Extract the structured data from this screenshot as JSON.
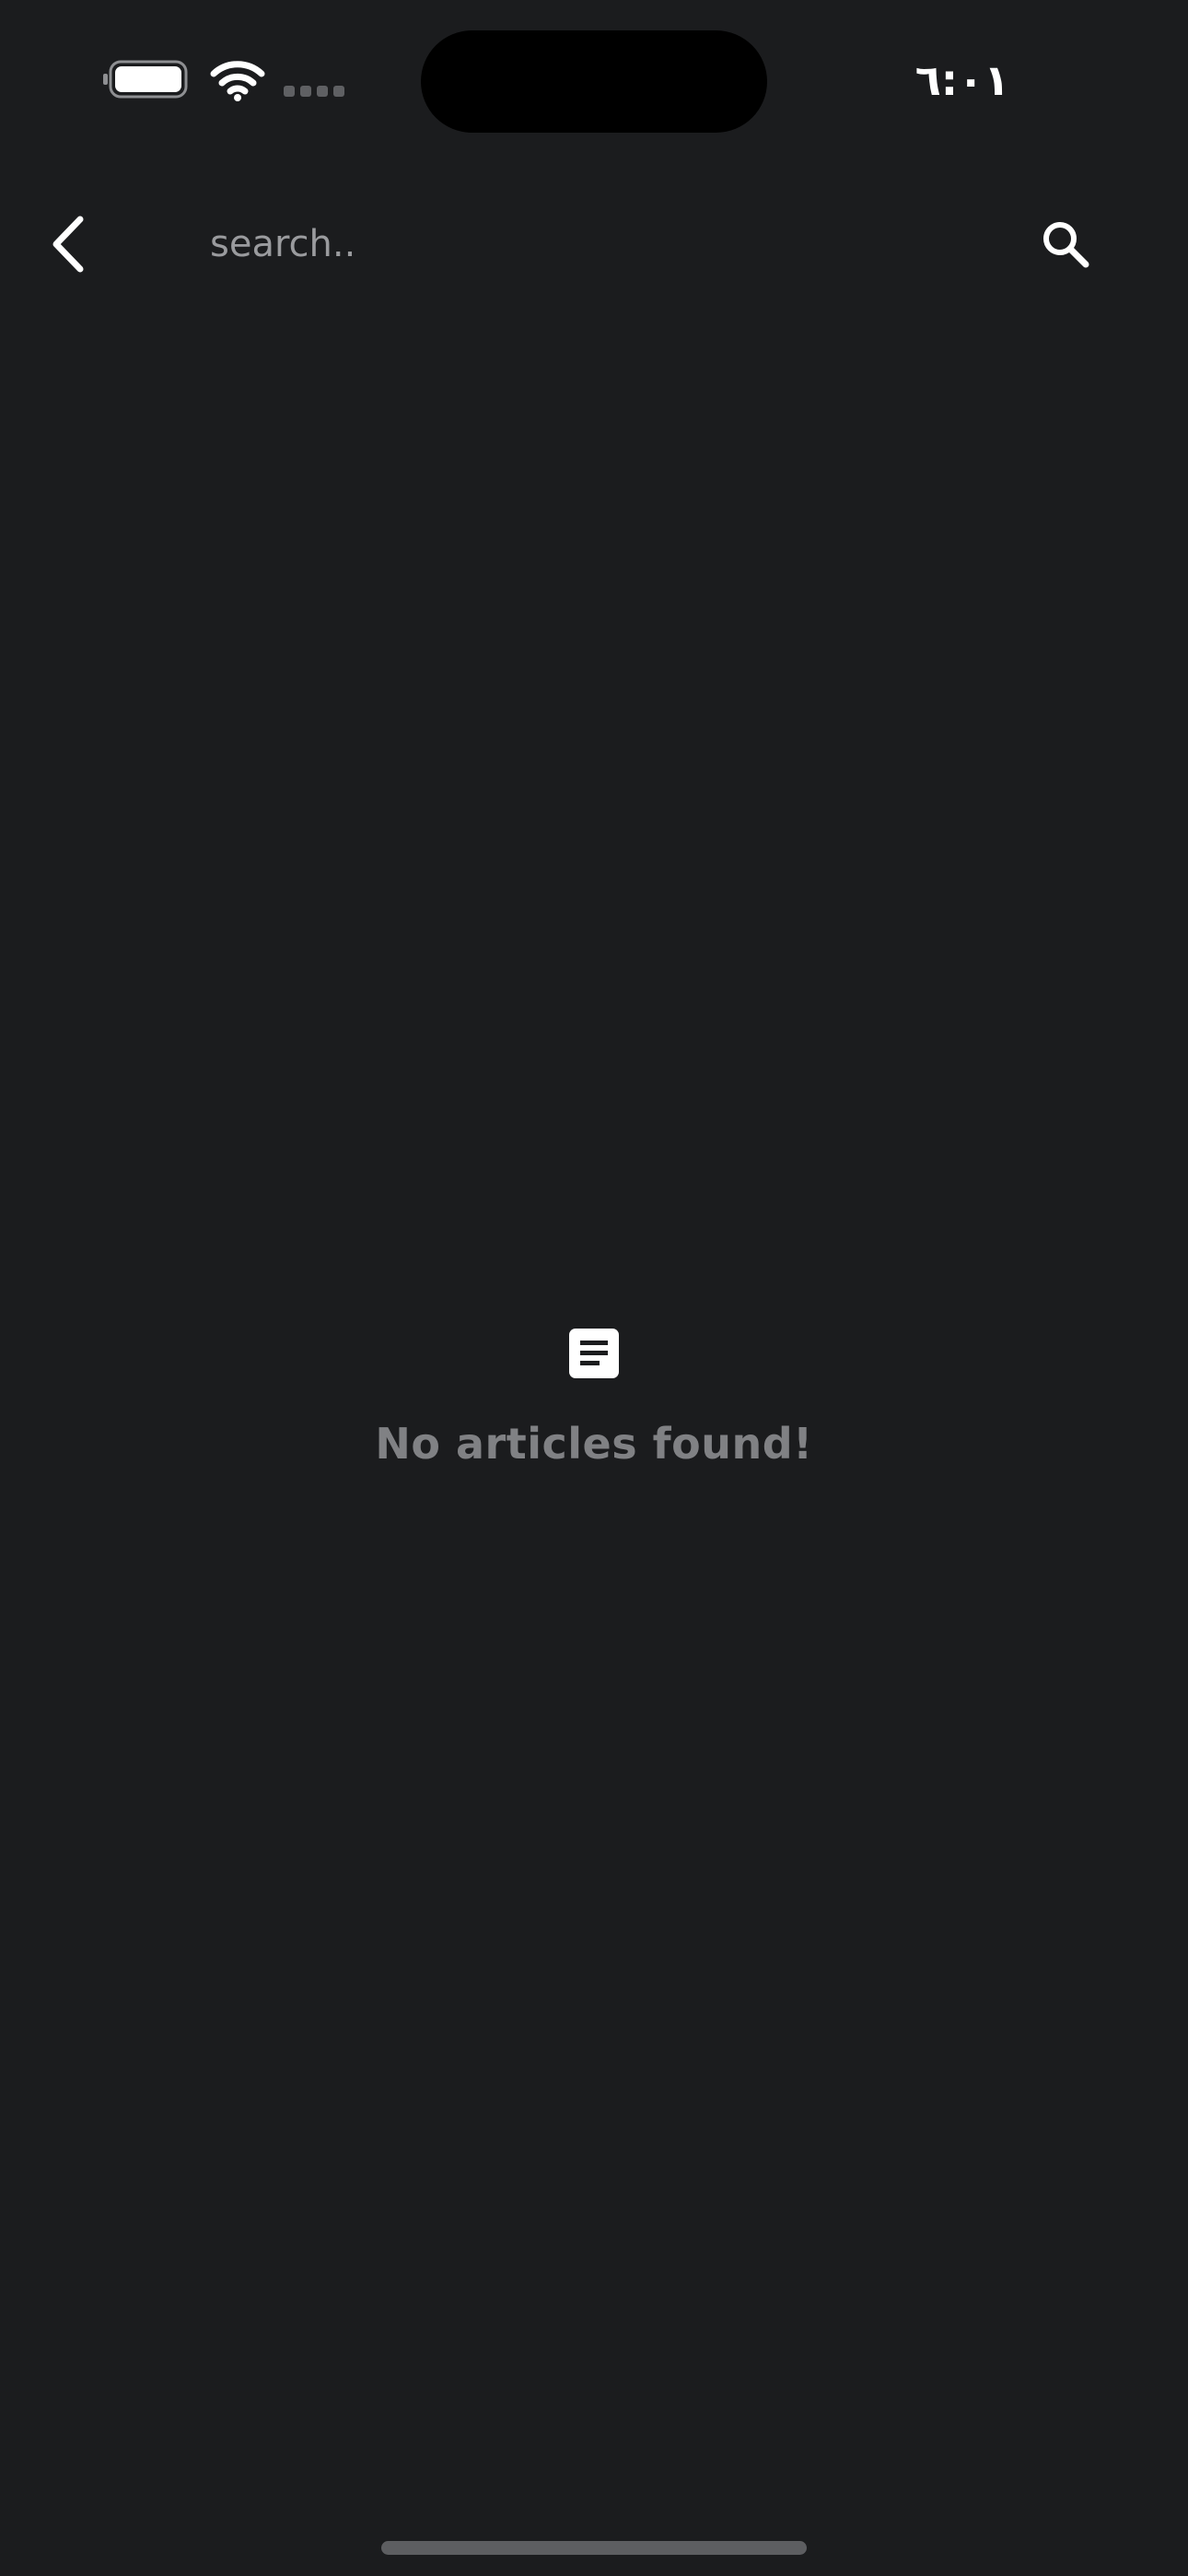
{
  "status_bar": {
    "time": "٦:٠١",
    "battery_icon": "battery-full-icon",
    "wifi_icon": "wifi-icon",
    "signal_icon": "cellular-signal-icon"
  },
  "header": {
    "back_icon": "chevron-left-icon",
    "search": {
      "placeholder": "search..",
      "value": ""
    },
    "search_icon": "magnifier-icon"
  },
  "empty_state": {
    "icon": "article-icon",
    "message": "No articles found!"
  },
  "colors": {
    "background": "#1b1c1e",
    "placeholder": "#9a9b9e",
    "empty_text": "#808184",
    "home_indicator": "#5d5e61"
  }
}
